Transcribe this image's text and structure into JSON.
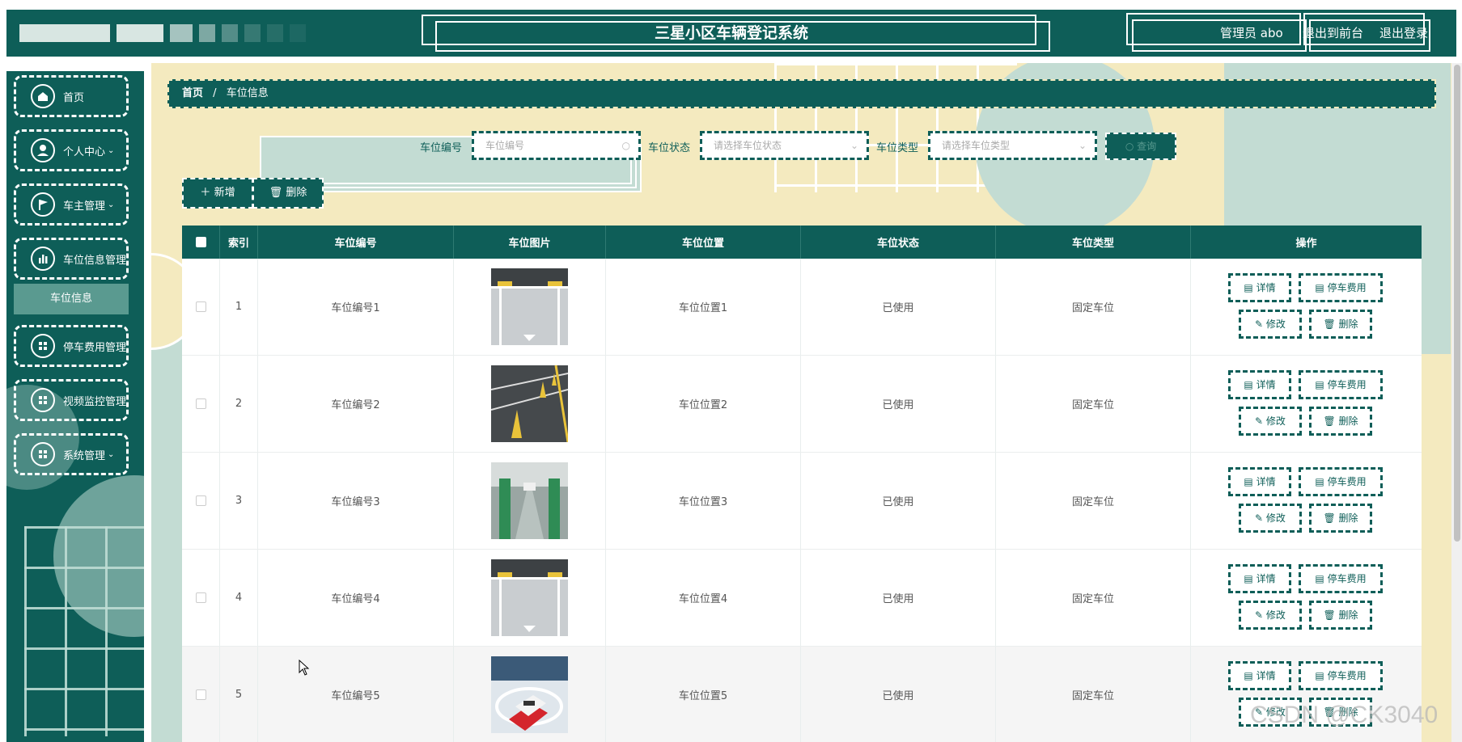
{
  "header": {
    "title": "三星小区车辆登记系统",
    "admin_label": "管理员 abo",
    "front_link": "退出到前台",
    "logout_link": "退出登录"
  },
  "sidebar": {
    "items": [
      {
        "label": "首页",
        "icon": "home-icon"
      },
      {
        "label": "个人中心",
        "icon": "user-icon",
        "expandable": true
      },
      {
        "label": "车主管理",
        "icon": "flag-icon",
        "expandable": true
      },
      {
        "label": "车位信息管理",
        "icon": "chart-icon"
      },
      {
        "label": "停车费用管理",
        "icon": "grid-icon"
      },
      {
        "label": "视频监控管理",
        "icon": "grid-icon"
      },
      {
        "label": "系统管理",
        "icon": "grid-icon",
        "expandable": true
      }
    ],
    "sub_item": "车位信息"
  },
  "breadcrumb": {
    "home": "首页",
    "separator": "/",
    "current": "车位信息"
  },
  "search": {
    "code_label": "车位编号",
    "code_placeholder": "车位编号",
    "status_label": "车位状态",
    "status_placeholder": "请选择车位状态",
    "type_label": "车位类型",
    "type_placeholder": "请选择车位类型",
    "search_button": "查询"
  },
  "actions": {
    "add": "新增",
    "delete": "删除"
  },
  "table": {
    "headers": [
      "索引",
      "车位编号",
      "车位图片",
      "车位位置",
      "车位状态",
      "车位类型",
      "操作"
    ],
    "rows": [
      {
        "index": "1",
        "code": "车位编号1",
        "location": "车位位置1",
        "status": "已使用",
        "type": "固定车位"
      },
      {
        "index": "2",
        "code": "车位编号2",
        "location": "车位位置2",
        "status": "已使用",
        "type": "固定车位"
      },
      {
        "index": "3",
        "code": "车位编号3",
        "location": "车位位置3",
        "status": "已使用",
        "type": "固定车位"
      },
      {
        "index": "4",
        "code": "车位编号4",
        "location": "车位位置4",
        "status": "已使用",
        "type": "固定车位"
      },
      {
        "index": "5",
        "code": "车位编号5",
        "location": "车位位置5",
        "status": "已使用",
        "type": "固定车位"
      }
    ],
    "op_labels": {
      "detail": "详情",
      "fee": "停车费用",
      "edit": "修改",
      "delete": "删除"
    }
  },
  "watermark": "CSDN @CK3040",
  "colors": {
    "primary": "#0e5e58",
    "accent_light": "#c3dcd3",
    "background_cream": "#f4eabf"
  }
}
